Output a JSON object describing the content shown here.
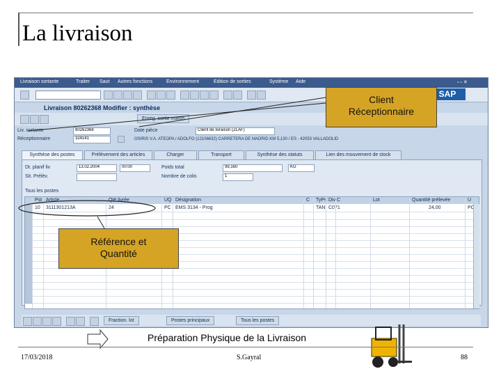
{
  "slide": {
    "title": "La livraison",
    "date": "17/03/2018",
    "author": "S.Gayral",
    "page": "88"
  },
  "sap": {
    "menu": [
      "Livraison sortante",
      "Traiter",
      "Saut",
      "Autres fonctions",
      "Environnement",
      "Edition de sorties",
      "Système",
      "Aide"
    ],
    "logo": "SAP",
    "screen_title": "Livraison 80262368 Modifier : synthèse",
    "app_button": "Enreg. sortie march",
    "header": {
      "delivery_label": "Liv. sortante",
      "delivery_value": "80262368",
      "ship_to_label": "Réceptionnaire",
      "ship_to_value": "324141",
      "doc_date_label": "Date pièce",
      "type_value": "Client de livraison   (ZLAF)",
      "address": "OSIRIS V.A. ATEOPA / ADOLFO (12106632) CARRETERA DE MADRID KM 5,130 / ES - 42053 VALLADOLID"
    },
    "tabs": [
      "Synthèse des postes",
      "Prélèvement des articles",
      "Charger",
      "Transport",
      "Synthèse des statuts",
      "Lien des mouvement de stock"
    ],
    "fields": {
      "delivery_date_label": "Dt. planif liv",
      "delivery_date": "13.02.2004",
      "time": "00:00",
      "weight_label": "Poids total",
      "weight": "99,160",
      "weight_unit": "KG",
      "picking_label": "Sit. Prélèv.",
      "packages_label": "Nombre de colis",
      "packages": "1"
    },
    "table": {
      "caption": "Tous les postes",
      "headers": [
        "Pst",
        "Article",
        "Qté livrée",
        "UQ",
        "Désignation",
        "C",
        "TyPs",
        "Div",
        "C",
        "Lot",
        "Quantité prélevée",
        "U"
      ],
      "row": [
        "10",
        "3111301213A",
        "24",
        "PC",
        "EMS 3134 - Prog",
        "",
        "TAN",
        "C071",
        "",
        "",
        "24,00",
        "PC"
      ]
    },
    "bottom_buttons": [
      "Fraction. lot",
      "Postes principaux",
      "Tous les postes"
    ]
  },
  "callouts": {
    "client": "Client\nRéceptionnaire",
    "reference": "Référence et\nQuantité",
    "preparation": "Préparation Physique de la Livraison"
  },
  "colors": {
    "callout": "#d6a425",
    "sap_bg": "#c7d6e8",
    "menubar": "#3b5a8d"
  }
}
